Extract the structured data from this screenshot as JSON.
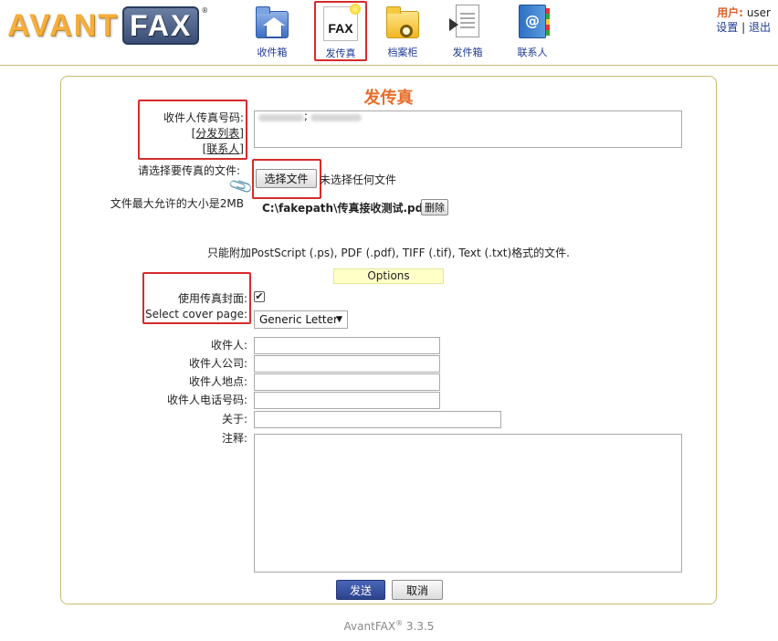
{
  "header": {
    "logo_avant": "AVANT",
    "logo_fax": "FAX",
    "logo_reg": "®",
    "nav": [
      {
        "label": "收件箱",
        "icon": "inbox-icon"
      },
      {
        "label": "发传真",
        "icon": "fax-icon",
        "active": true
      },
      {
        "label": "档案柜",
        "icon": "archive-icon"
      },
      {
        "label": "发件箱",
        "icon": "outbox-icon"
      },
      {
        "label": "联系人",
        "icon": "contacts-icon"
      }
    ],
    "user_label": "用户:",
    "user_name": "user",
    "settings_link": "设置",
    "separator": "|",
    "logout_link": "退出",
    "fax_icon_text": "FAX",
    "contacts_icon_text": "@"
  },
  "form": {
    "title": "发传真",
    "recipient_fax_label": "收件人传真号码:",
    "distribution_list_link": "[分发列表]",
    "contacts_link": "[联系人]",
    "fax_separator": ";",
    "choose_file_label": "请选择要传真的文件:",
    "max_size_label": "文件最大允许的大小是2MB",
    "choose_file_button": "选择文件",
    "no_file_text": "未选择任何文件",
    "attached_file": "C:\\fakepath\\传真接收测试.pdf",
    "delete_button": "删除",
    "allowed_formats": "只能附加PostScript (.ps), PDF (.pdf), TIFF (.tif), Text (.txt)格式的文件.",
    "options_label": "Options",
    "use_cover_label": "使用传真封面:",
    "use_cover_checked": true,
    "checkmark": "✔",
    "select_cover_label": "Select cover page:",
    "cover_page_value": "Generic Letter",
    "caret": "▼",
    "to_label": "收件人:",
    "company_label": "收件人公司:",
    "location_label": "收件人地点:",
    "phone_label": "收件人电话号码:",
    "subject_label": "关于:",
    "comments_label": "注释:",
    "send_button": "发送",
    "cancel_button": "取消"
  },
  "footer": {
    "product": "AvantFAX",
    "reg": "®",
    "version": "3.3.5"
  },
  "colors": {
    "accent_orange": "#e86d2a",
    "link_blue": "#1f3a93",
    "highlight_red": "#d62b2b",
    "panel_border": "#c9bb6e"
  }
}
